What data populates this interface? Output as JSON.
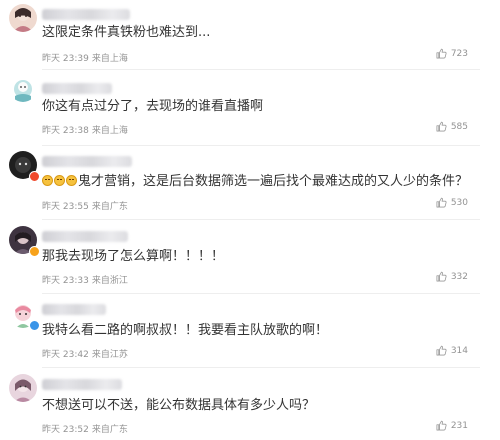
{
  "comments": [
    {
      "text": "这限定条件真铁粉也难达到...",
      "time": "昨天 23:39",
      "location": "来自上海",
      "likes": "723",
      "avatar_color": "#e9c7b8",
      "has_emoji": false
    },
    {
      "text": "你这有点过分了，去现场的谁看直播啊",
      "time": "昨天 23:38",
      "location": "来自上海",
      "likes": "585",
      "avatar_color": "#bfe0e2",
      "has_emoji": false
    },
    {
      "text": "鬼才营销，这是后台数据筛选一遍后找个最难达成的又人少的条件？",
      "time": "昨天 23:55",
      "location": "来自广东",
      "likes": "530",
      "avatar_color": "#2a2a2a",
      "has_emoji": true
    },
    {
      "text": "那我去现场了怎么算啊！！！！",
      "time": "昨天 23:33",
      "location": "来自浙江",
      "likes": "332",
      "avatar_color": "#4a3a46",
      "has_emoji": false
    },
    {
      "text": "我特么看二路的啊叔叔！！我要看主队放歌的啊！",
      "time": "昨天 23:42",
      "location": "来自江苏",
      "likes": "314",
      "avatar_color": "#f1c8cf",
      "has_emoji": false
    },
    {
      "text": "不想送可以不送，能公布数据具体有多少人吗？",
      "time": "昨天 23:52",
      "location": "来自广东",
      "likes": "231",
      "avatar_color": "#d7b9c8",
      "has_emoji": false
    }
  ]
}
